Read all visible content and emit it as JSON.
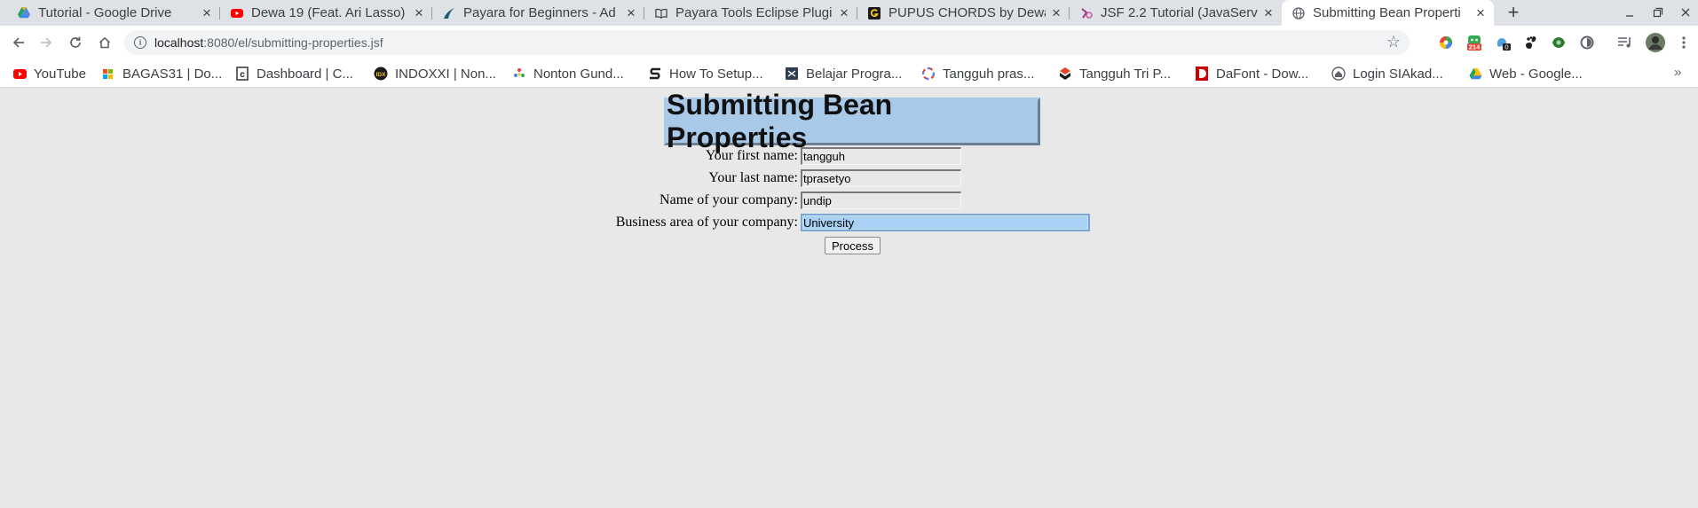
{
  "browser": {
    "tabs": [
      {
        "title": "Tutorial - Google Drive",
        "icon": "google-drive-icon"
      },
      {
        "title": "Dewa 19 (Feat. Ari Lasso)",
        "icon": "youtube-icon"
      },
      {
        "title": "Payara for Beginners - Ad",
        "icon": "payara-icon"
      },
      {
        "title": "Payara Tools Eclipse Plugi",
        "icon": "book-icon"
      },
      {
        "title": "PUPUS CHORDS by Dewa",
        "icon": "chords-icon"
      },
      {
        "title": "JSF 2.2 Tutorial (JavaServ",
        "icon": "tutorial-site-icon"
      },
      {
        "title": "Submitting Bean Properti",
        "icon": "globe-icon"
      }
    ],
    "address": {
      "host": "localhost",
      "path": ":8080/el/submitting-properties.jsf"
    },
    "extension_badges": {
      "ext_2": "214",
      "ext_3": "0"
    },
    "bookmarks": [
      {
        "label": "YouTube",
        "icon": "youtube-icon"
      },
      {
        "label": "BAGAS31 | Do...",
        "icon": "bagas31-icon"
      },
      {
        "label": "Dashboard | C...",
        "icon": "dashboard-icon"
      },
      {
        "label": "INDOXXI | Non...",
        "icon": "indoxxi-icon"
      },
      {
        "label": "Nonton Gund...",
        "icon": "nonton-icon"
      },
      {
        "label": "How To Setup...",
        "icon": "s-logo-icon"
      },
      {
        "label": "Belajar Progra...",
        "icon": "belajar-icon"
      },
      {
        "label": "Tangguh pras...",
        "icon": "ring-icon"
      },
      {
        "label": "Tangguh Tri P...",
        "icon": "tangguh-icon"
      },
      {
        "label": "DaFont - Dow...",
        "icon": "dafont-icon"
      },
      {
        "label": "Login SIAkad...",
        "icon": "siakad-icon"
      },
      {
        "label": "Web - Google...",
        "icon": "google-drive-icon"
      }
    ]
  },
  "form": {
    "title": "Submitting Bean Properties",
    "fields": [
      {
        "label": "Your first name:",
        "value": "tangguh"
      },
      {
        "label": "Your last name:",
        "value": "tprasetyo"
      },
      {
        "label": "Name of your company:",
        "value": "undip"
      },
      {
        "label": "Business area of your company:",
        "value": "University"
      }
    ],
    "submit_label": "Process"
  },
  "colors": {
    "page_background": "#e8e8e8",
    "title_background": "#a9c9e8",
    "focused_field": "#a9d1f5"
  }
}
